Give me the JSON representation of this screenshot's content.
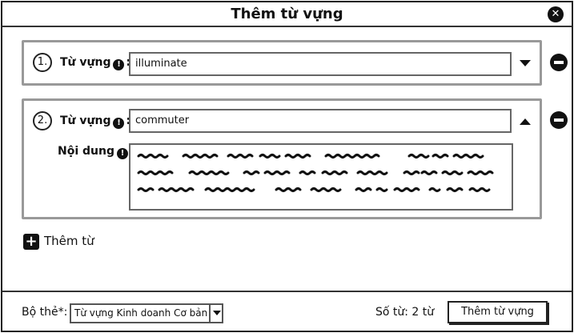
{
  "dialog": {
    "title": "Thêm từ vựng",
    "close_icon": "close-icon"
  },
  "entries": [
    {
      "number": "1.",
      "word_label": "Từ vựng",
      "word_value": "illuminate",
      "expanded": false
    },
    {
      "number": "2.",
      "word_label": "Từ vựng",
      "word_value": "commuter",
      "content_label": "Nội dung",
      "expanded": true
    }
  ],
  "icons": {
    "info": "!",
    "add": "+",
    "close": "✕"
  },
  "add_word": {
    "label": "Thêm từ"
  },
  "footer": {
    "deck_label": "Bộ thẻ*:",
    "deck_selected": "Từ vựng Kinh doanh Cơ bản",
    "word_count": "Số từ: 2 từ",
    "submit_label": "Thêm từ vựng"
  }
}
